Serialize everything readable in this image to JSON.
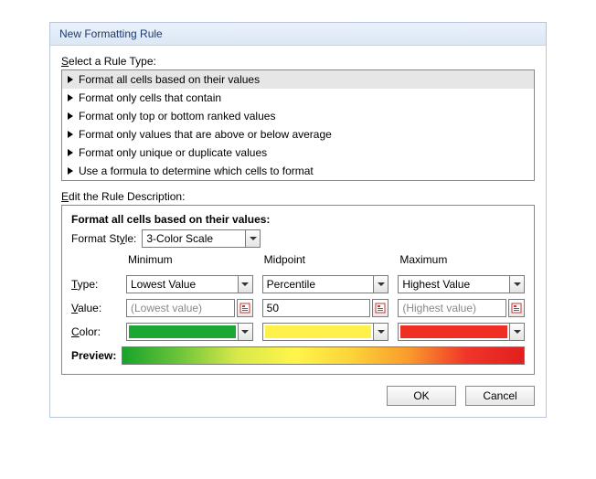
{
  "title": "New Formatting Rule",
  "ruleTypeLabel": {
    "pre": "S",
    "rest": "elect a Rule Type:"
  },
  "ruleTypes": [
    "Format all cells based on their values",
    "Format only cells that contain",
    "Format only top or bottom ranked values",
    "Format only values that are above or below average",
    "Format only unique or duplicate values",
    "Use a formula to determine which cells to format"
  ],
  "editDescLabel": {
    "pre": "E",
    "rest": "dit the Rule Description:"
  },
  "descHeading": "Format all cells based on their values:",
  "formatStyleLabel": {
    "pre": "Format St",
    "u": "y",
    "post": "le:"
  },
  "formatStyleValue": "3-Color Scale",
  "colHeads": {
    "min": "Minimum",
    "mid": "Midpoint",
    "max": "Maximum"
  },
  "rowLabels": {
    "type": {
      "u": "T",
      "rest": "ype:"
    },
    "value": {
      "u": "V",
      "rest": "alue:"
    },
    "color": {
      "u": "C",
      "rest": "olor:"
    }
  },
  "type": {
    "min": "Lowest Value",
    "mid": "Percentile",
    "max": "Highest Value"
  },
  "value": {
    "min": "(Lowest value)",
    "mid": "50",
    "max": "(Highest value)"
  },
  "color": {
    "min": "#1aa733",
    "mid": "#fff04a",
    "max": "#ef2e24"
  },
  "previewLabel": "Preview:",
  "buttons": {
    "ok": "OK",
    "cancel": "Cancel"
  }
}
